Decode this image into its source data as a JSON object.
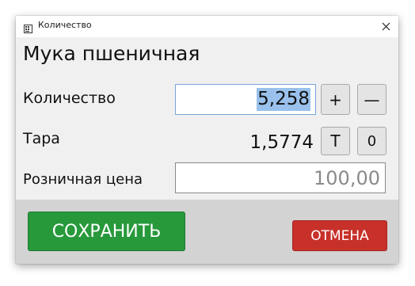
{
  "window": {
    "title": "Количество",
    "app_icon": "calculator-icon",
    "close_icon": "close-icon"
  },
  "product": {
    "name": "Мука пшеничная"
  },
  "quantity": {
    "label": "Количество",
    "value": "5,258",
    "plus_label": "+",
    "minus_label": "—"
  },
  "tare": {
    "label": "Тара",
    "value": "1,5774",
    "t_label": "Т",
    "zero_label": "0"
  },
  "price": {
    "label": "Розничная цена",
    "value": "100,00"
  },
  "actions": {
    "save_label": "СОХРАНИТЬ",
    "cancel_label": "ОТМЕНА"
  },
  "colors": {
    "save": "#27993b",
    "cancel": "#c8312a",
    "selection": "#99c1ec",
    "footer": "#d3d3d3"
  }
}
